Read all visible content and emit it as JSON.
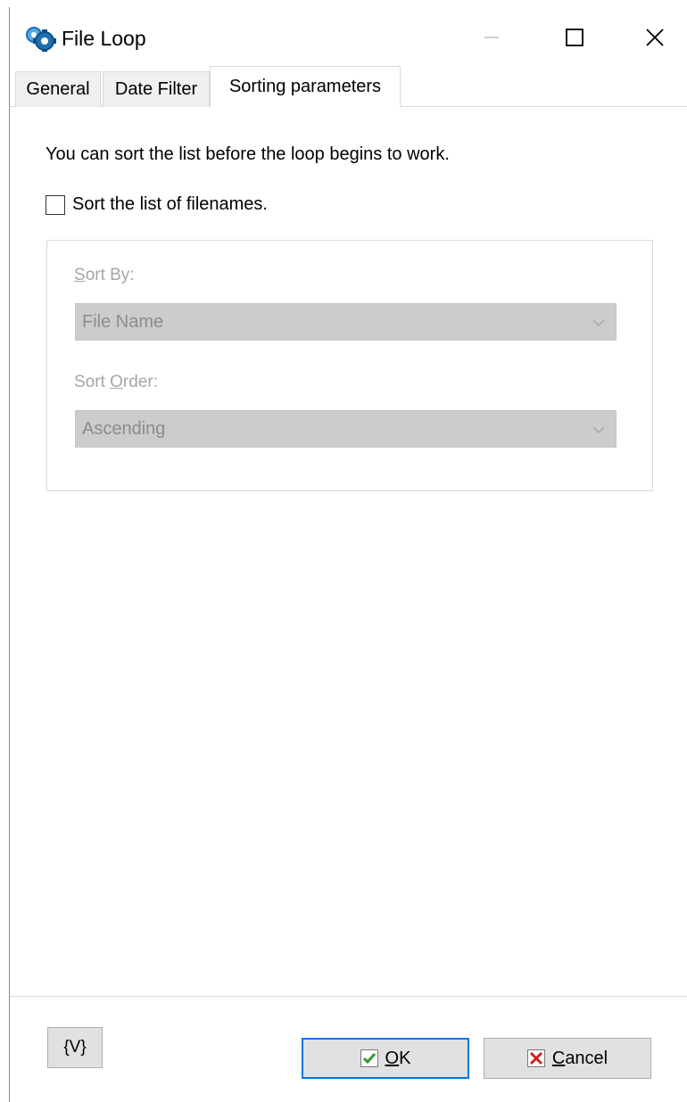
{
  "window": {
    "title": "File Loop"
  },
  "tabs": [
    {
      "label": "General",
      "active": false
    },
    {
      "label": "Date Filter",
      "active": false
    },
    {
      "label": "Sorting parameters",
      "active": true
    }
  ],
  "content": {
    "intro_text": "You can sort the list before the loop begins to work.",
    "sort_checkbox": {
      "label": "Sort the list of filenames.",
      "checked": false
    },
    "sort_by": {
      "label_first": "S",
      "label_rest": "ort By:",
      "value": "File Name",
      "enabled": false
    },
    "sort_order": {
      "label_pre": "Sort ",
      "label_accel": "O",
      "label_rest": "rder:",
      "value": "Ascending",
      "enabled": false
    }
  },
  "buttons": {
    "variables": "{V}",
    "ok_accel": "O",
    "ok_rest": "K",
    "cancel_accel": "C",
    "cancel_rest": "ancel"
  },
  "icons": {
    "app": "gears-icon",
    "ok": "checkmark-icon",
    "cancel": "red-x-icon"
  },
  "colors": {
    "ok_border": "#0078d7",
    "ok_check": "#2e9a2e",
    "cancel_x": "#d42020"
  }
}
